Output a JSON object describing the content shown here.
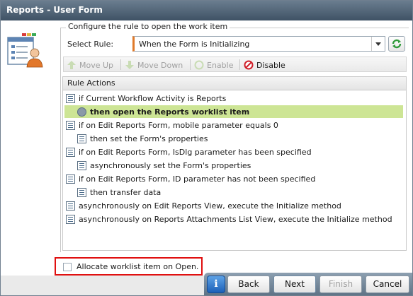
{
  "window": {
    "title": "Reports - User Form"
  },
  "group": {
    "legend": "Configure the rule to open the work item"
  },
  "select_rule": {
    "label": "Select Rule:",
    "value": "When the Form is Initializing"
  },
  "toolbar": {
    "move_up": "Move Up",
    "move_down": "Move Down",
    "enable": "Enable",
    "disable": "Disable"
  },
  "rule_actions": {
    "header": "Rule Actions",
    "items": [
      {
        "text": "if Current Workflow Activity is Reports",
        "indent": 0,
        "selected": false,
        "icon": "list-icon"
      },
      {
        "text": "then open the Reports worklist item",
        "indent": 1,
        "selected": true,
        "icon": "gear-icon"
      },
      {
        "text": "if on Edit Reports Form, mobile parameter equals 0",
        "indent": 0,
        "selected": false,
        "icon": "list-icon"
      },
      {
        "text": "then set the Form's properties",
        "indent": 1,
        "selected": false,
        "icon": "list-icon"
      },
      {
        "text": "if on Edit Reports Form, IsDlg parameter has been specified",
        "indent": 0,
        "selected": false,
        "icon": "list-icon"
      },
      {
        "text": "asynchronously set the Form's properties",
        "indent": 1,
        "selected": false,
        "icon": "list-icon"
      },
      {
        "text": "if on Edit Reports Form, ID parameter has not been specified",
        "indent": 0,
        "selected": false,
        "icon": "list-icon"
      },
      {
        "text": "then transfer data",
        "indent": 1,
        "selected": false,
        "icon": "list-icon"
      },
      {
        "text": "asynchronously on Edit Reports View, execute the Initialize method",
        "indent": 0,
        "selected": false,
        "icon": "list-icon"
      },
      {
        "text": "asynchronously on Reports Attachments List View, execute the Initialize method",
        "indent": 0,
        "selected": false,
        "icon": "list-icon"
      }
    ]
  },
  "allocate": {
    "label": "Allocate worklist item on Open.",
    "checked": false
  },
  "buttons": {
    "back": "Back",
    "next": "Next",
    "finish": "Finish",
    "cancel": "Cancel",
    "info": "i"
  },
  "colors": {
    "accent": "#e07a2a",
    "selection": "#cde595",
    "highlight_border": "#e01010"
  }
}
